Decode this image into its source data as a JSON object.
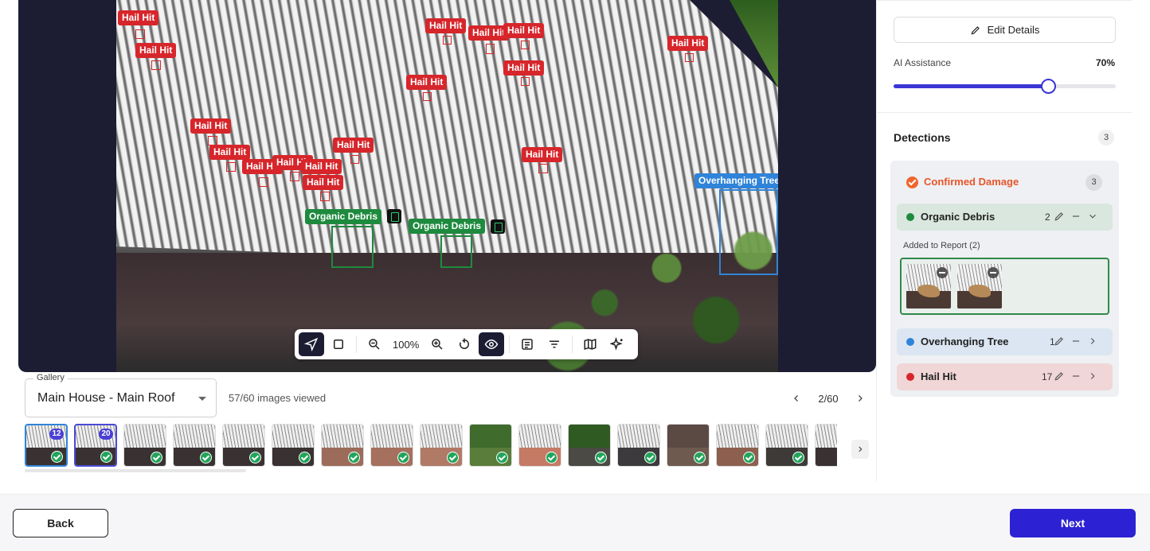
{
  "viewer": {
    "hail_label": "Hail Hit",
    "debris_label": "Organic Debris",
    "tree_label": "Overhanging Tree"
  },
  "toolbar": {
    "zoom": "100%",
    "tools": [
      "select-pointer-icon",
      "rectangle-icon",
      "zoom-out-icon",
      "zoom-in-icon",
      "rotate-icon",
      "eye-icon",
      "notes-icon",
      "filter-icon",
      "map-icon",
      "ai-sparkle-icon"
    ],
    "active_tools": [
      "select-pointer-icon",
      "eye-icon"
    ]
  },
  "gallery": {
    "label": "Gallery",
    "selected": "Main House - Main Roof",
    "viewed": "57/60 images viewed",
    "page": "2/60",
    "thumb_badges": [
      "12",
      "20"
    ]
  },
  "right_panel": {
    "edit_details": "Edit Details",
    "ai_assistance_label": "AI Assistance",
    "ai_assistance_value": "70%",
    "ai_assistance_fraction": 0.7,
    "detections_title": "Detections",
    "detections_count": "3",
    "confirmed_label": "Confirmed Damage",
    "confirmed_count": "3",
    "categories": [
      {
        "name": "Organic Debris",
        "count": "2",
        "color": "#1e8a3e"
      },
      {
        "name": "Overhanging Tree",
        "count": "1",
        "color": "#2f84d9"
      },
      {
        "name": "Hail Hit",
        "count": "17",
        "color": "#d7262b"
      }
    ],
    "added_to_report": "Added to Report (2)"
  },
  "footer": {
    "back": "Back",
    "next": "Next"
  },
  "colors": {
    "primary": "#2c22d3",
    "hail": "#d7262b",
    "debris": "#1e8a3e",
    "tree": "#2f84d9",
    "confirmed": "#e8552a"
  }
}
